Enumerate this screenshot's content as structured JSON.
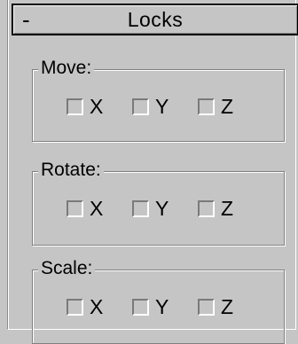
{
  "rollout": {
    "collapse_sign": "-",
    "title": "Locks"
  },
  "groups": {
    "move": {
      "label": "Move:",
      "x": "X",
      "y": "Y",
      "z": "Z",
      "x_checked": false,
      "y_checked": false,
      "z_checked": false
    },
    "rotate": {
      "label": "Rotate:",
      "x": "X",
      "y": "Y",
      "z": "Z",
      "x_checked": false,
      "y_checked": false,
      "z_checked": false
    },
    "scale": {
      "label": "Scale:",
      "x": "X",
      "y": "Y",
      "z": "Z",
      "x_checked": false,
      "y_checked": false,
      "z_checked": false
    }
  }
}
